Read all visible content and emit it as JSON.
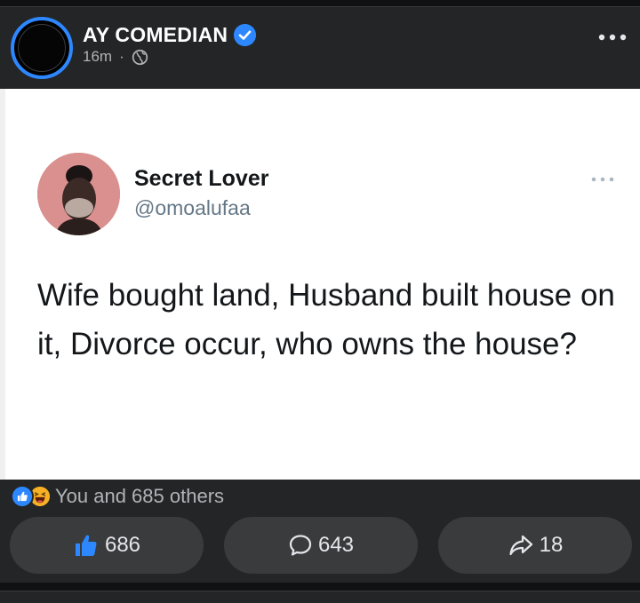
{
  "post": {
    "page_name": "AY COMEDIAN",
    "time": "16m",
    "separator": "·",
    "icons": {
      "verified": "verified-badge-icon",
      "audience": "globe-icon",
      "more": "more-options-icon"
    }
  },
  "tweet": {
    "display_name": "Secret Lover",
    "handle": "@omoalufaa",
    "text": "Wife bought land, Husband built house on it, Divorce occur, who owns the house?"
  },
  "reactions": {
    "summary": "You and 685 others",
    "icons": [
      "like-reaction-icon",
      "haha-reaction-icon"
    ]
  },
  "actions": {
    "like_count": "686",
    "comment_count": "643",
    "share_count": "18"
  },
  "colors": {
    "accent": "#2d88ff",
    "background": "#242526",
    "button": "#3a3b3c",
    "muted_text": "#b0b3b8"
  }
}
